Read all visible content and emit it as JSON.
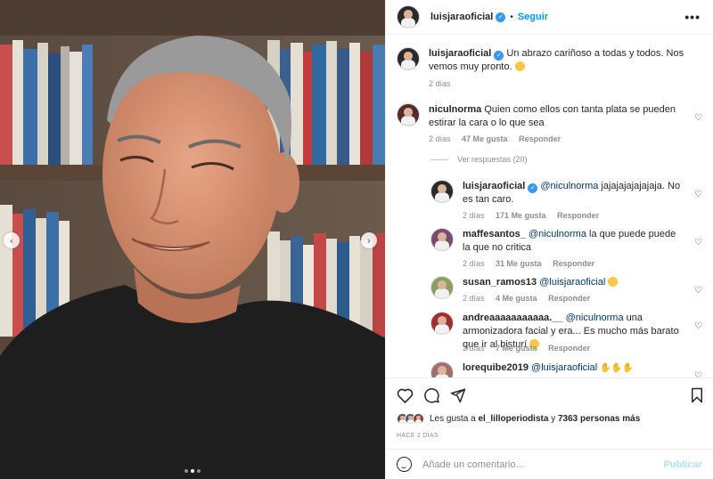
{
  "post": {
    "username": "luisjaraoficial",
    "follow_label": "Seguir",
    "separator": "•",
    "more_label": "•••",
    "caption": {
      "username": "luisjaraoficial",
      "text": "Un abrazo cariñoso a todas y todos. Nos vemos muy pronto.",
      "time": "2 días"
    }
  },
  "comments": [
    {
      "username": "niculnorma",
      "text": "Quien como ellos con tanta plata se pueden estirar la cara o lo que sea",
      "time": "2 días",
      "likes": "47 Me gusta",
      "reply": "Responder"
    }
  ],
  "view_replies_label": "Ver respuestas (20)",
  "replies": [
    {
      "username": "luisjaraoficial",
      "mention": "@niculnorma",
      "text": "jajajajajajajaja. No es tan caro.",
      "time": "2 días",
      "likes": "171 Me gusta",
      "reply": "Responder"
    },
    {
      "username": "maffesantos_",
      "mention": "@niculnorma",
      "text": "la que puede puede la que no critica",
      "time": "2 días",
      "likes": "31 Me gusta",
      "reply": "Responder"
    },
    {
      "username": "susan_ramos13",
      "mention": "@luisjaraoficial",
      "text": "",
      "time": "2 días",
      "likes": "4 Me gusta",
      "reply": "Responder"
    },
    {
      "username": "andreaaaaaaaaaaa.__",
      "mention": "@niculnorma",
      "text": "una armonizadora facial y era... Es mucho más barato que ir al bisturí",
      "time": "2 días",
      "likes": "7 Me gusta",
      "reply": "Responder"
    },
    {
      "username": "lorequibe2019",
      "mention": "@luisjaraoficial",
      "text": ""
    }
  ],
  "likes": {
    "prefix": "Les gusta a",
    "user": "el_lilloperiodista",
    "connector": "y",
    "count": "7363 personas más"
  },
  "time_ago": "HACE 2 DÍAS",
  "composer": {
    "placeholder": "Añade un comentario...",
    "publish_label": "Publicar"
  },
  "carousel": {
    "current": 2,
    "total": 3
  },
  "colors": {
    "accent": "#0095f6",
    "verified": "#3897f0",
    "muted": "#8e8e8e"
  },
  "icons": [
    "chevron-left-icon",
    "chevron-right-icon",
    "verified-icon",
    "heart-icon",
    "comment-icon",
    "share-icon",
    "bookmark-icon",
    "emoji-icon",
    "more-icon"
  ]
}
